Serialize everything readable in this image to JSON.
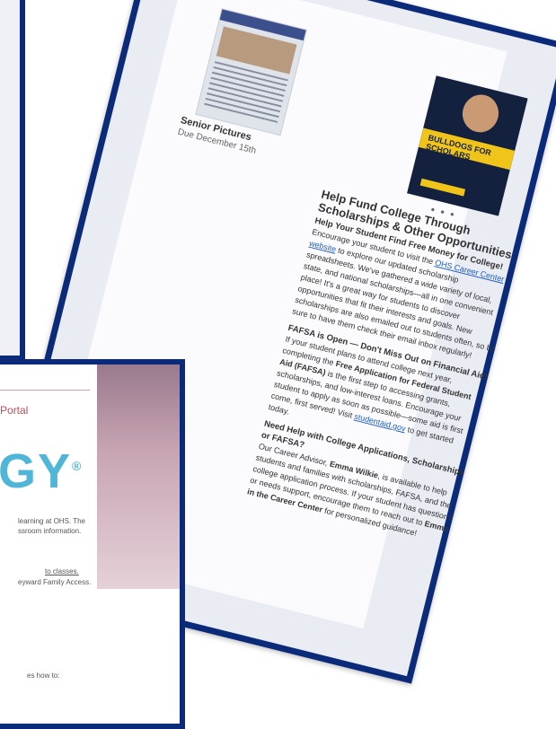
{
  "newsletter": {
    "senior_pictures_title": "Senior Pictures",
    "senior_pictures_sub": "Due December 15th",
    "flyer_text": "BULLDOGS FOR SCHOLARS",
    "heading": "Help Fund College Through Scholarships & Other Opportunities",
    "subheading": "Help Your Student Find Free Money for College!",
    "para1_a": "Encourage your student to visit the ",
    "para1_link": "OHS Career Center website",
    "para1_b": " to explore our updated scholarship spreadsheets. We've gathered a wide variety of local, state, and national scholarships—all in one convenient place! It's a great way for students to discover opportunities that fit their interests and goals. New scholarships are also emailed out to students often, so be sure to have them check their email inbox regularly!",
    "fafsa_heading": "FAFSA is Open — Don't Miss Out on Financial Aid!",
    "para2_a": "If your student plans to attend college next year, completing the ",
    "para2_strong": "Free Application for Federal Student Aid (FAFSA)",
    "para2_b": " is the first step to accessing grants, scholarships, and low-interest loans. Encourage your student to apply as soon as possible—some aid is first come, first served! Visit ",
    "para2_link": "studentaid.gov",
    "para2_c": " to get started today.",
    "help_heading": "Need Help with College Applications, Scholarships or FAFSA?",
    "para3_a": "Our Career Advisor, ",
    "para3_strong1": "Emma Wilkie",
    "para3_b": ", is available to help students and families with scholarships, FAFSA, and the college application process. If your student has questions or needs support, encourage them to reach out to ",
    "para3_strong2": "Emma in the Career Center",
    "para3_c": " for personalized guidance!"
  },
  "portal": {
    "label": "Portal",
    "logo": "GY",
    "logo_mark": "®",
    "line1": "learning at OHS. The",
    "line2": "ssroom information.",
    "line3_link": "to classes.",
    "line4": "eyward Family Access.",
    "line5": "es how to:"
  }
}
